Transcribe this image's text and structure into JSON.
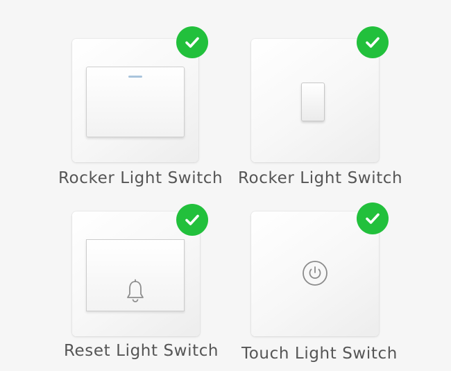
{
  "switches": [
    {
      "label": "Rocker Light Switch",
      "icon": "check-icon"
    },
    {
      "label": "Rocker Light Switch",
      "icon": "check-icon"
    },
    {
      "label": "Reset Light Switch",
      "icon": "check-icon"
    },
    {
      "label": "Touch Light Switch",
      "icon": "check-icon"
    }
  ],
  "colors": {
    "check": "#22c03c",
    "label": "#555555",
    "background": "#f6f6f6"
  }
}
